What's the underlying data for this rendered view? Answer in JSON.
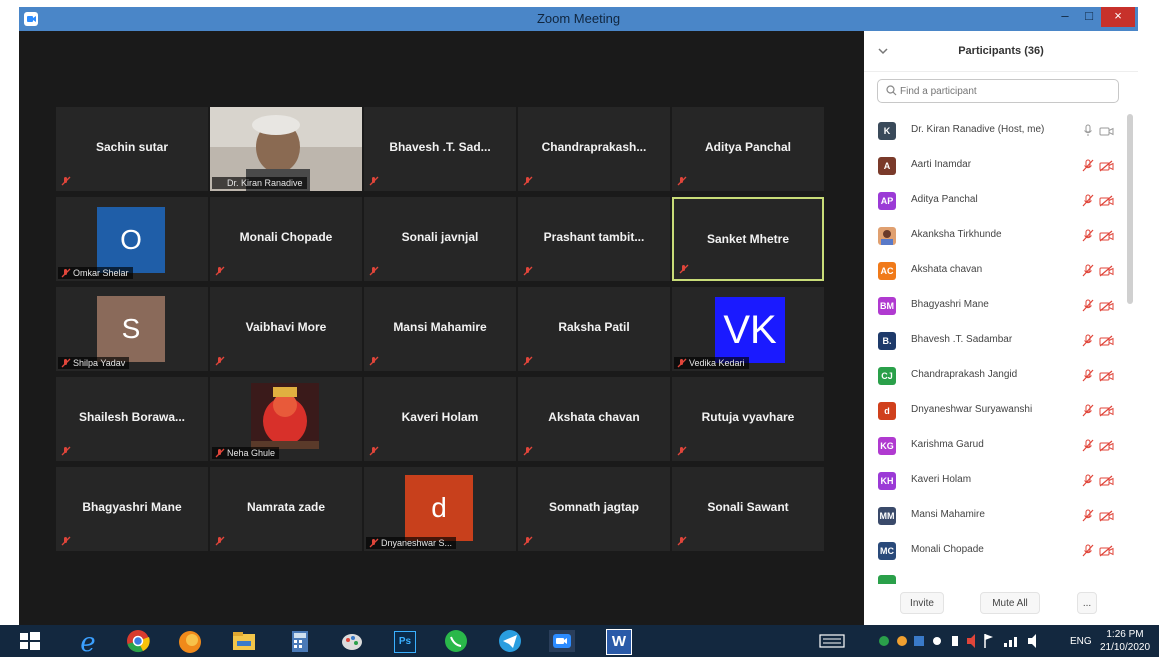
{
  "window": {
    "title": "Zoom Meeting",
    "min_label": "–",
    "max_label": "□",
    "close_label": "×"
  },
  "tiles": [
    {
      "name": "Sachin sutar",
      "muted": true
    },
    {
      "name": "Dr. Kiran Ranadive",
      "has_video": true
    },
    {
      "name": "Bhavesh .T. Sad...",
      "muted": true
    },
    {
      "name": "Chandraprakash...",
      "muted": true
    },
    {
      "name": "Aditya Panchal",
      "muted": true
    },
    {
      "name": "Omkar Shelar",
      "avatar_letter": "O",
      "avatar_color": "#1f5ea8",
      "muted": true
    },
    {
      "name": "Monali Chopade",
      "muted": true
    },
    {
      "name": "Sonali javnjal",
      "muted": true
    },
    {
      "name": "Prashant tambit...",
      "muted": true
    },
    {
      "name": "Sanket Mhetre",
      "muted": true,
      "active_speaker": true
    },
    {
      "name": "Shilpa Yadav",
      "avatar_letter": "S",
      "avatar_color": "#8a6a5a",
      "muted": true
    },
    {
      "name": "Vaibhavi More",
      "muted": true
    },
    {
      "name": "Mansi Mahamire",
      "muted": true
    },
    {
      "name": "Raksha Patil",
      "muted": true
    },
    {
      "name": "Vedika Kedari",
      "avatar_letter": "VK",
      "avatar_color": "#1a1aff",
      "muted": true
    },
    {
      "name": "Shailesh Borawa...",
      "muted": true
    },
    {
      "name": "Neha Ghule",
      "has_image": true,
      "muted": true
    },
    {
      "name": "Kaveri Holam",
      "muted": true
    },
    {
      "name": "Akshata chavan",
      "muted": true
    },
    {
      "name": "Rutuja vyavhare",
      "muted": true
    },
    {
      "name": "Bhagyashri Mane",
      "muted": true
    },
    {
      "name": "Namrata zade",
      "muted": true
    },
    {
      "name": "Dnyaneshwar S...",
      "avatar_letter": "d",
      "avatar_color": "#c8401c",
      "muted": true
    },
    {
      "name": "Somnath jagtap",
      "muted": true
    },
    {
      "name": "Sonali Sawant",
      "muted": true
    }
  ],
  "participants_panel": {
    "title": "Participants (36)",
    "search_placeholder": "Find a participant",
    "participants": [
      {
        "initials": "K",
        "color": "#3a4a5a",
        "name": "Dr. Kiran Ranadive (Host, me)",
        "host": true
      },
      {
        "initials": "A",
        "color": "#7a3a2a",
        "name": "Aarti Inamdar"
      },
      {
        "initials": "AP",
        "color": "#9b3ad6",
        "name": "Aditya Panchal"
      },
      {
        "initials": "",
        "color": "#e0a070",
        "name": "Akanksha Tirkhunde",
        "photo": true
      },
      {
        "initials": "AC",
        "color": "#f07a1a",
        "name": "Akshata chavan"
      },
      {
        "initials": "BM",
        "color": "#b03ad0",
        "name": "Bhagyashri Mane"
      },
      {
        "initials": "B.",
        "color": "#1e3a6a",
        "name": "Bhavesh .T. Sadambar"
      },
      {
        "initials": "CJ",
        "color": "#2aa04a",
        "name": "Chandraprakash Jangid"
      },
      {
        "initials": "d",
        "color": "#d0401c",
        "name": "Dnyaneshwar Suryawanshi"
      },
      {
        "initials": "KG",
        "color": "#b03ad0",
        "name": "Karishma Garud"
      },
      {
        "initials": "KH",
        "color": "#9b3ad6",
        "name": "Kaveri Holam"
      },
      {
        "initials": "MM",
        "color": "#3a4a6a",
        "name": "Mansi Mahamire"
      },
      {
        "initials": "MC",
        "color": "#2a4a7a",
        "name": "Monali Chopade"
      }
    ],
    "invite_label": "Invite",
    "mute_all_label": "Mute All",
    "more_label": "..."
  },
  "taskbar": {
    "apps": [
      "windows-start",
      "internet-explorer",
      "chrome",
      "firefox",
      "file-explorer",
      "calculator",
      "paint",
      "photoshop",
      "whatsapp",
      "telegram",
      "zoom",
      "word"
    ],
    "photoshop_label": "Ps",
    "word_label": "W",
    "language": "ENG",
    "time": "1:26 PM",
    "date": "21/10/2020"
  }
}
